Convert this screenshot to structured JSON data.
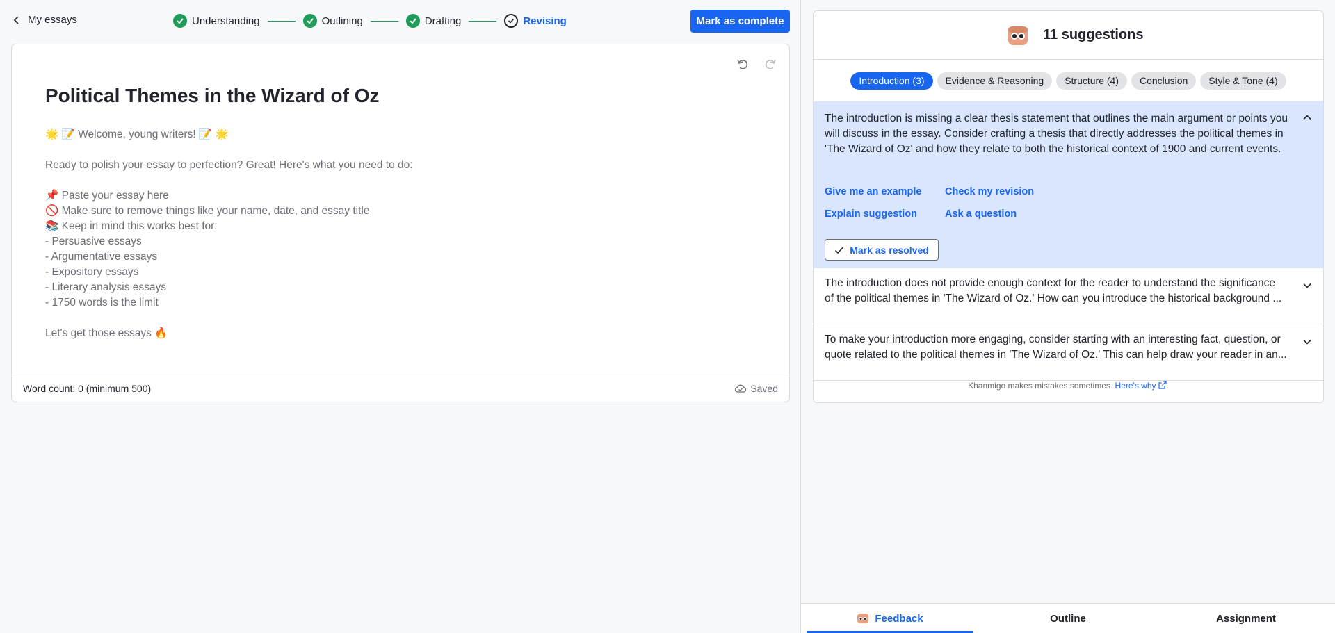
{
  "nav": {
    "back_label": "My essays",
    "steps": [
      {
        "label": "Understanding",
        "state": "done"
      },
      {
        "label": "Outlining",
        "state": "done"
      },
      {
        "label": "Drafting",
        "state": "done"
      },
      {
        "label": "Revising",
        "state": "current"
      }
    ],
    "complete_label": "Mark as complete"
  },
  "editor": {
    "title": "Political Themes in the Wizard of Oz",
    "lines": [
      "🌟 📝 Welcome, young writers! 📝 🌟",
      "",
      "Ready to polish your essay to perfection? Great! Here's what you need to do:",
      "",
      "📌 Paste your essay here",
      "🚫 Make sure to remove things like your name, date, and essay title",
      "📚 Keep in mind this works best for:",
      "- Persuasive essays",
      "- Argumentative essays",
      "- Expository essays",
      "- Literary analysis essays",
      "- 1750 words is the limit",
      "",
      "Let's get those essays 🔥"
    ],
    "word_count": "Word count: 0 (minimum 500)",
    "saved_label": "Saved"
  },
  "feedback": {
    "title": "11 suggestions",
    "chips": [
      {
        "label": "Introduction (3)",
        "active": true
      },
      {
        "label": "Evidence & Reasoning",
        "active": false
      },
      {
        "label": "Structure (4)",
        "active": false
      },
      {
        "label": "Conclusion",
        "active": false
      },
      {
        "label": "Style & Tone (4)",
        "active": false
      }
    ],
    "expanded": {
      "text": "The introduction is missing a clear thesis statement that outlines the main argument or points you will discuss in the essay. Consider crafting a thesis that directly addresses the political themes in 'The Wizard of Oz' and how they relate to both the historical context of 1900 and current events.",
      "actions": [
        "Give me an example",
        "Check my revision",
        "Explain suggestion",
        "Ask a question"
      ],
      "resolve_label": "Mark as resolved"
    },
    "collapsed": [
      {
        "line1": "The introduction does not provide enough context for the reader to understand the significance",
        "line2": "of the political themes in 'The Wizard of Oz.' How can you introduce the historical background ..."
      },
      {
        "line1": "To make your introduction more engaging, consider starting with an interesting fact, question, or",
        "line2": "quote related to the political themes in 'The Wizard of Oz.' This can help draw your reader in an..."
      }
    ],
    "disclaimer": "Khanmigo makes mistakes sometimes.",
    "disclaimer_link": "Here's why"
  },
  "tabs": [
    {
      "label": "Feedback",
      "active": true
    },
    {
      "label": "Outline",
      "active": false
    },
    {
      "label": "Assignment",
      "active": false
    }
  ],
  "colors": {
    "accent": "#1865f2",
    "success": "#1f9b5a",
    "highlight": "#d9e6fd"
  }
}
